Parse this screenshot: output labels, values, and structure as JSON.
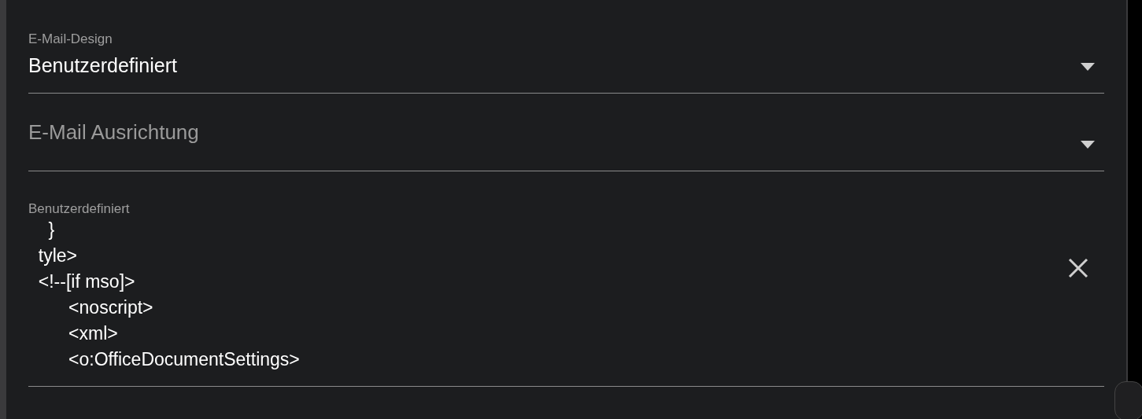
{
  "fields": [
    {
      "kind": "select",
      "label": "E-Mail-Design",
      "value": "Benutzerdefiniert"
    },
    {
      "kind": "select",
      "placeholder": "E-Mail Ausrichtung"
    },
    {
      "kind": "textarea",
      "label": "Benutzerdefiniert",
      "lines": [
        "    }",
        "  tyle>",
        "  <!--[if mso]>",
        "        <noscript>",
        "        <xml>",
        "        <o:OfficeDocumentSettings>"
      ]
    }
  ]
}
